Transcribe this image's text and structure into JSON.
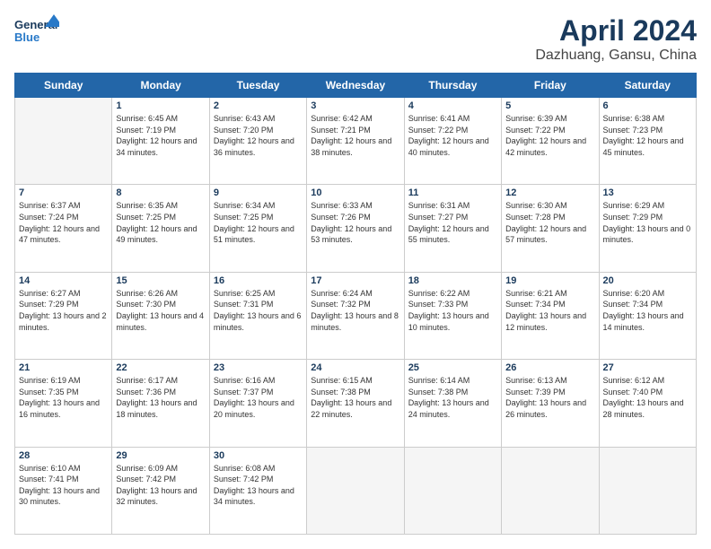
{
  "header": {
    "logo_line1": "General",
    "logo_line2": "Blue",
    "title": "April 2024",
    "subtitle": "Dazhuang, Gansu, China"
  },
  "days_of_week": [
    "Sunday",
    "Monday",
    "Tuesday",
    "Wednesday",
    "Thursday",
    "Friday",
    "Saturday"
  ],
  "weeks": [
    [
      {
        "day": "",
        "empty": true
      },
      {
        "day": "1",
        "sunrise": "6:45 AM",
        "sunset": "7:19 PM",
        "daylight": "12 hours and 34 minutes."
      },
      {
        "day": "2",
        "sunrise": "6:43 AM",
        "sunset": "7:20 PM",
        "daylight": "12 hours and 36 minutes."
      },
      {
        "day": "3",
        "sunrise": "6:42 AM",
        "sunset": "7:21 PM",
        "daylight": "12 hours and 38 minutes."
      },
      {
        "day": "4",
        "sunrise": "6:41 AM",
        "sunset": "7:22 PM",
        "daylight": "12 hours and 40 minutes."
      },
      {
        "day": "5",
        "sunrise": "6:39 AM",
        "sunset": "7:22 PM",
        "daylight": "12 hours and 42 minutes."
      },
      {
        "day": "6",
        "sunrise": "6:38 AM",
        "sunset": "7:23 PM",
        "daylight": "12 hours and 45 minutes."
      }
    ],
    [
      {
        "day": "7",
        "sunrise": "6:37 AM",
        "sunset": "7:24 PM",
        "daylight": "12 hours and 47 minutes."
      },
      {
        "day": "8",
        "sunrise": "6:35 AM",
        "sunset": "7:25 PM",
        "daylight": "12 hours and 49 minutes."
      },
      {
        "day": "9",
        "sunrise": "6:34 AM",
        "sunset": "7:25 PM",
        "daylight": "12 hours and 51 minutes."
      },
      {
        "day": "10",
        "sunrise": "6:33 AM",
        "sunset": "7:26 PM",
        "daylight": "12 hours and 53 minutes."
      },
      {
        "day": "11",
        "sunrise": "6:31 AM",
        "sunset": "7:27 PM",
        "daylight": "12 hours and 55 minutes."
      },
      {
        "day": "12",
        "sunrise": "6:30 AM",
        "sunset": "7:28 PM",
        "daylight": "12 hours and 57 minutes."
      },
      {
        "day": "13",
        "sunrise": "6:29 AM",
        "sunset": "7:29 PM",
        "daylight": "13 hours and 0 minutes."
      }
    ],
    [
      {
        "day": "14",
        "sunrise": "6:27 AM",
        "sunset": "7:29 PM",
        "daylight": "13 hours and 2 minutes."
      },
      {
        "day": "15",
        "sunrise": "6:26 AM",
        "sunset": "7:30 PM",
        "daylight": "13 hours and 4 minutes."
      },
      {
        "day": "16",
        "sunrise": "6:25 AM",
        "sunset": "7:31 PM",
        "daylight": "13 hours and 6 minutes."
      },
      {
        "day": "17",
        "sunrise": "6:24 AM",
        "sunset": "7:32 PM",
        "daylight": "13 hours and 8 minutes."
      },
      {
        "day": "18",
        "sunrise": "6:22 AM",
        "sunset": "7:33 PM",
        "daylight": "13 hours and 10 minutes."
      },
      {
        "day": "19",
        "sunrise": "6:21 AM",
        "sunset": "7:34 PM",
        "daylight": "13 hours and 12 minutes."
      },
      {
        "day": "20",
        "sunrise": "6:20 AM",
        "sunset": "7:34 PM",
        "daylight": "13 hours and 14 minutes."
      }
    ],
    [
      {
        "day": "21",
        "sunrise": "6:19 AM",
        "sunset": "7:35 PM",
        "daylight": "13 hours and 16 minutes."
      },
      {
        "day": "22",
        "sunrise": "6:17 AM",
        "sunset": "7:36 PM",
        "daylight": "13 hours and 18 minutes."
      },
      {
        "day": "23",
        "sunrise": "6:16 AM",
        "sunset": "7:37 PM",
        "daylight": "13 hours and 20 minutes."
      },
      {
        "day": "24",
        "sunrise": "6:15 AM",
        "sunset": "7:38 PM",
        "daylight": "13 hours and 22 minutes."
      },
      {
        "day": "25",
        "sunrise": "6:14 AM",
        "sunset": "7:38 PM",
        "daylight": "13 hours and 24 minutes."
      },
      {
        "day": "26",
        "sunrise": "6:13 AM",
        "sunset": "7:39 PM",
        "daylight": "13 hours and 26 minutes."
      },
      {
        "day": "27",
        "sunrise": "6:12 AM",
        "sunset": "7:40 PM",
        "daylight": "13 hours and 28 minutes."
      }
    ],
    [
      {
        "day": "28",
        "sunrise": "6:10 AM",
        "sunset": "7:41 PM",
        "daylight": "13 hours and 30 minutes."
      },
      {
        "day": "29",
        "sunrise": "6:09 AM",
        "sunset": "7:42 PM",
        "daylight": "13 hours and 32 minutes."
      },
      {
        "day": "30",
        "sunrise": "6:08 AM",
        "sunset": "7:42 PM",
        "daylight": "13 hours and 34 minutes."
      },
      {
        "day": "",
        "empty": true
      },
      {
        "day": "",
        "empty": true
      },
      {
        "day": "",
        "empty": true
      },
      {
        "day": "",
        "empty": true
      }
    ]
  ]
}
